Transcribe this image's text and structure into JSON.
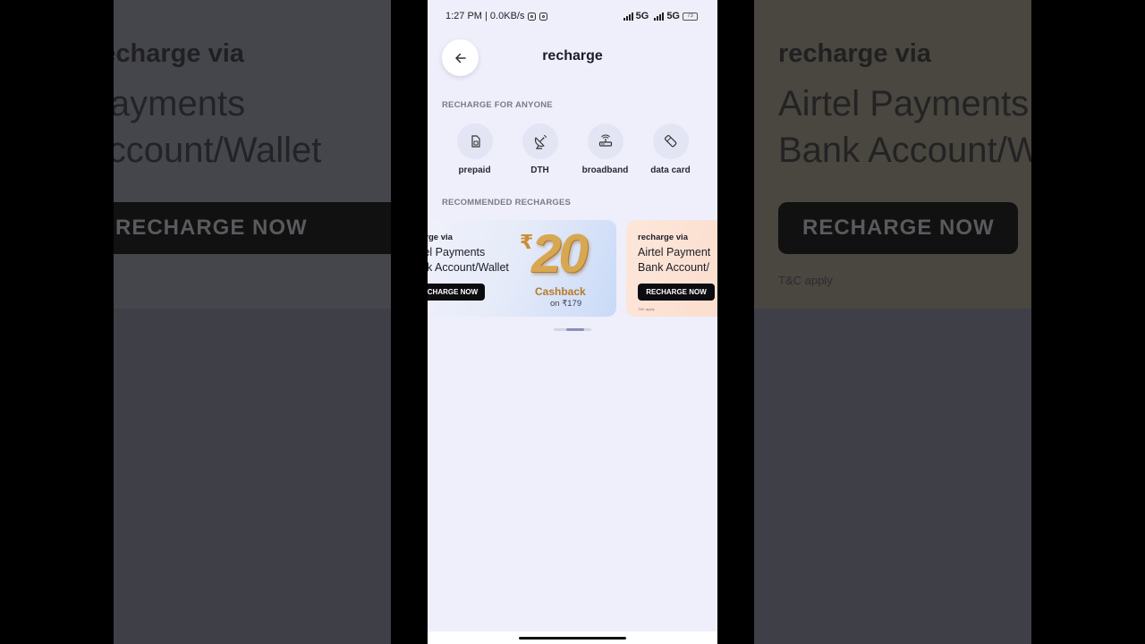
{
  "status_bar": {
    "time_speed": "1:27 PM | 0.0KB/s",
    "network1": "5G",
    "network2": "5G",
    "battery": "73"
  },
  "header": {
    "title": "recharge"
  },
  "recharge_for_anyone": {
    "heading": "RECHARGE FOR ANYONE",
    "items": [
      {
        "label": "prepaid",
        "icon": "sim-card-icon"
      },
      {
        "label": "DTH",
        "icon": "satellite-dish-icon"
      },
      {
        "label": "broadband",
        "icon": "router-icon"
      },
      {
        "label": "data card",
        "icon": "usb-dongle-icon"
      }
    ]
  },
  "recommended": {
    "heading": "RECOMMENDED RECHARGES",
    "cards": [
      {
        "via": "arge via",
        "line1": "tel Payments",
        "line2": "nk Account/Wallet",
        "button": "CHARGE NOW",
        "cashback_symbol": "₹",
        "cashback_amount": "20",
        "cashback_word": "Cashback",
        "cashback_on": "on ₹179"
      },
      {
        "via": "recharge via",
        "line1": "Airtel Payment",
        "line2": "Bank Account/",
        "button": "RECHARGE NOW",
        "tnc": "T&C apply"
      }
    ]
  },
  "background": {
    "via": "recharge via",
    "line1": "Airtel Payments",
    "line2": "Bank Account/Wallet",
    "button": "RECHARGE NOW",
    "tnc": "T&C apply"
  }
}
